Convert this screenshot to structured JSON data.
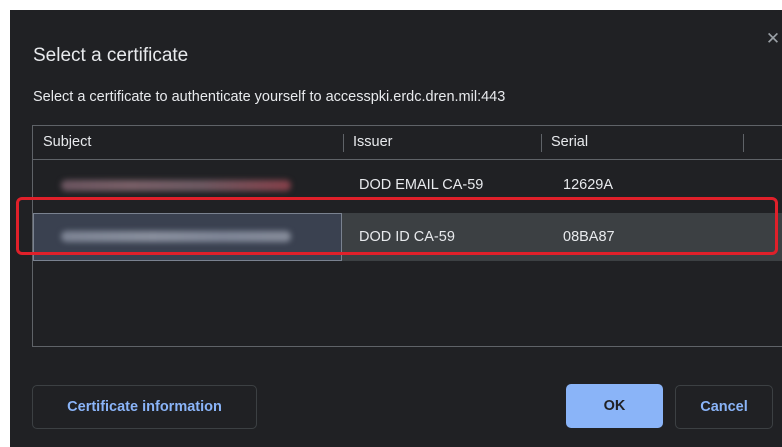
{
  "dialog": {
    "title": "Select a certificate",
    "subtitle": "Select a certificate to authenticate yourself to accesspki.erdc.dren.mil:443",
    "close_icon": "close-icon"
  },
  "table": {
    "columns": [
      "Subject",
      "Issuer",
      "Serial"
    ],
    "rows": [
      {
        "subject": "",
        "issuer": "DOD EMAIL CA-59",
        "serial": "12629A",
        "selected": false
      },
      {
        "subject": "",
        "issuer": "DOD ID CA-59",
        "serial": "08BA87",
        "selected": true
      }
    ]
  },
  "buttons": {
    "certificate_info": "Certificate information",
    "ok": "OK",
    "cancel": "Cancel"
  },
  "colors": {
    "background": "#202124",
    "accent": "#8ab4f8",
    "selected_row": "#3c4043",
    "highlight_outline": "#e0202a"
  }
}
